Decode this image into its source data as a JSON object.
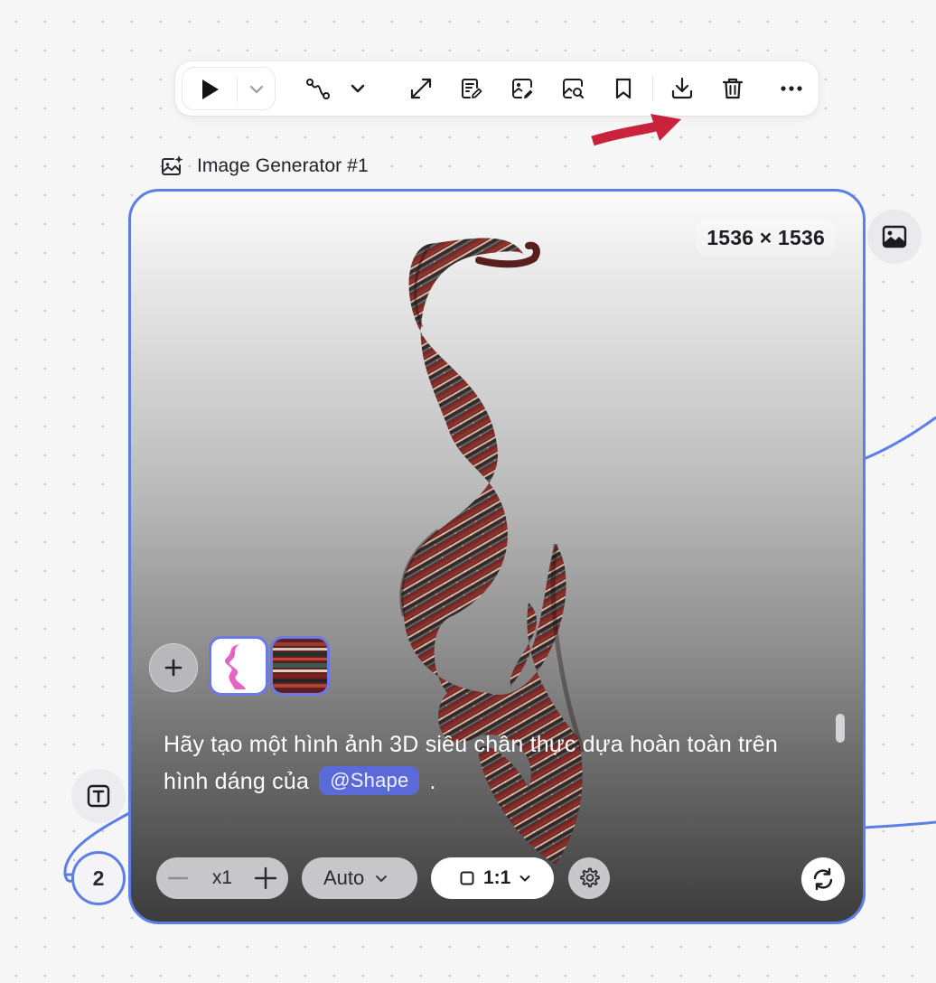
{
  "colors": {
    "accent": "#5b7fe6",
    "annotation_arrow": "#c8233a",
    "mention_bg": "#5a6ad8"
  },
  "toolbar": {
    "buttons": [
      {
        "name": "play-button",
        "icon": "play-icon"
      },
      {
        "name": "run-options-button",
        "icon": "chevron-down-icon"
      },
      {
        "name": "connect-button",
        "icon": "curve-path-icon"
      },
      {
        "name": "connect-options-button",
        "icon": "chevron-down-icon"
      },
      {
        "name": "expand-button",
        "icon": "expand-arrows-icon"
      },
      {
        "name": "edit-prompt-button",
        "icon": "edit-document-icon"
      },
      {
        "name": "edit-image-button",
        "icon": "image-edit-icon"
      },
      {
        "name": "image-search-button",
        "icon": "image-search-icon"
      },
      {
        "name": "bookmark-button",
        "icon": "bookmark-icon"
      },
      {
        "name": "download-button",
        "icon": "download-icon"
      },
      {
        "name": "delete-button",
        "icon": "trash-icon"
      },
      {
        "name": "more-button",
        "icon": "more-horizontal-icon"
      }
    ]
  },
  "node": {
    "title": "Image Generator #1",
    "title_icon": "image-sparkle-icon",
    "dimensions": "1536 × 1536",
    "references": [
      {
        "name": "Shape",
        "icon": "shape-thumbnail"
      },
      {
        "name": "Pattern",
        "icon": "pattern-thumbnail"
      }
    ],
    "prompt": {
      "text_before": "Hãy tạo một hình ảnh 3D siêu chân thực dựa hoàn toàn trên hình dáng của",
      "mention": "@Shape",
      "text_after": "."
    },
    "controls": {
      "quantity": "x1",
      "model": "Auto",
      "aspect_ratio": "1:1"
    }
  },
  "side": {
    "connected_count": "2"
  }
}
